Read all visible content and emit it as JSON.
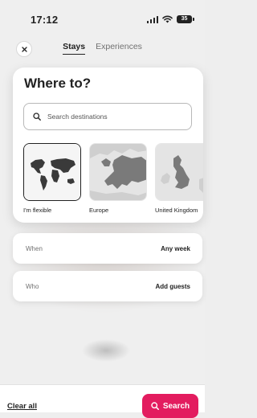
{
  "status_bar": {
    "time": "17:12",
    "battery": "35"
  },
  "tabs": [
    {
      "label": "Stays",
      "active": true
    },
    {
      "label": "Experiences",
      "active": false
    }
  ],
  "card": {
    "title": "Where to?",
    "search_placeholder": "Search destinations",
    "regions": [
      {
        "label": "I'm flexible",
        "selected": true
      },
      {
        "label": "Europe",
        "selected": false
      },
      {
        "label": "United Kingdom",
        "selected": false
      }
    ]
  },
  "when": {
    "label": "When",
    "value": "Any week"
  },
  "who": {
    "label": "Who",
    "value": "Add guests"
  },
  "footer": {
    "clear_label": "Clear all",
    "search_label": "Search"
  },
  "colors": {
    "accent": "#e31c5f",
    "text": "#222222",
    "muted": "#717171"
  }
}
